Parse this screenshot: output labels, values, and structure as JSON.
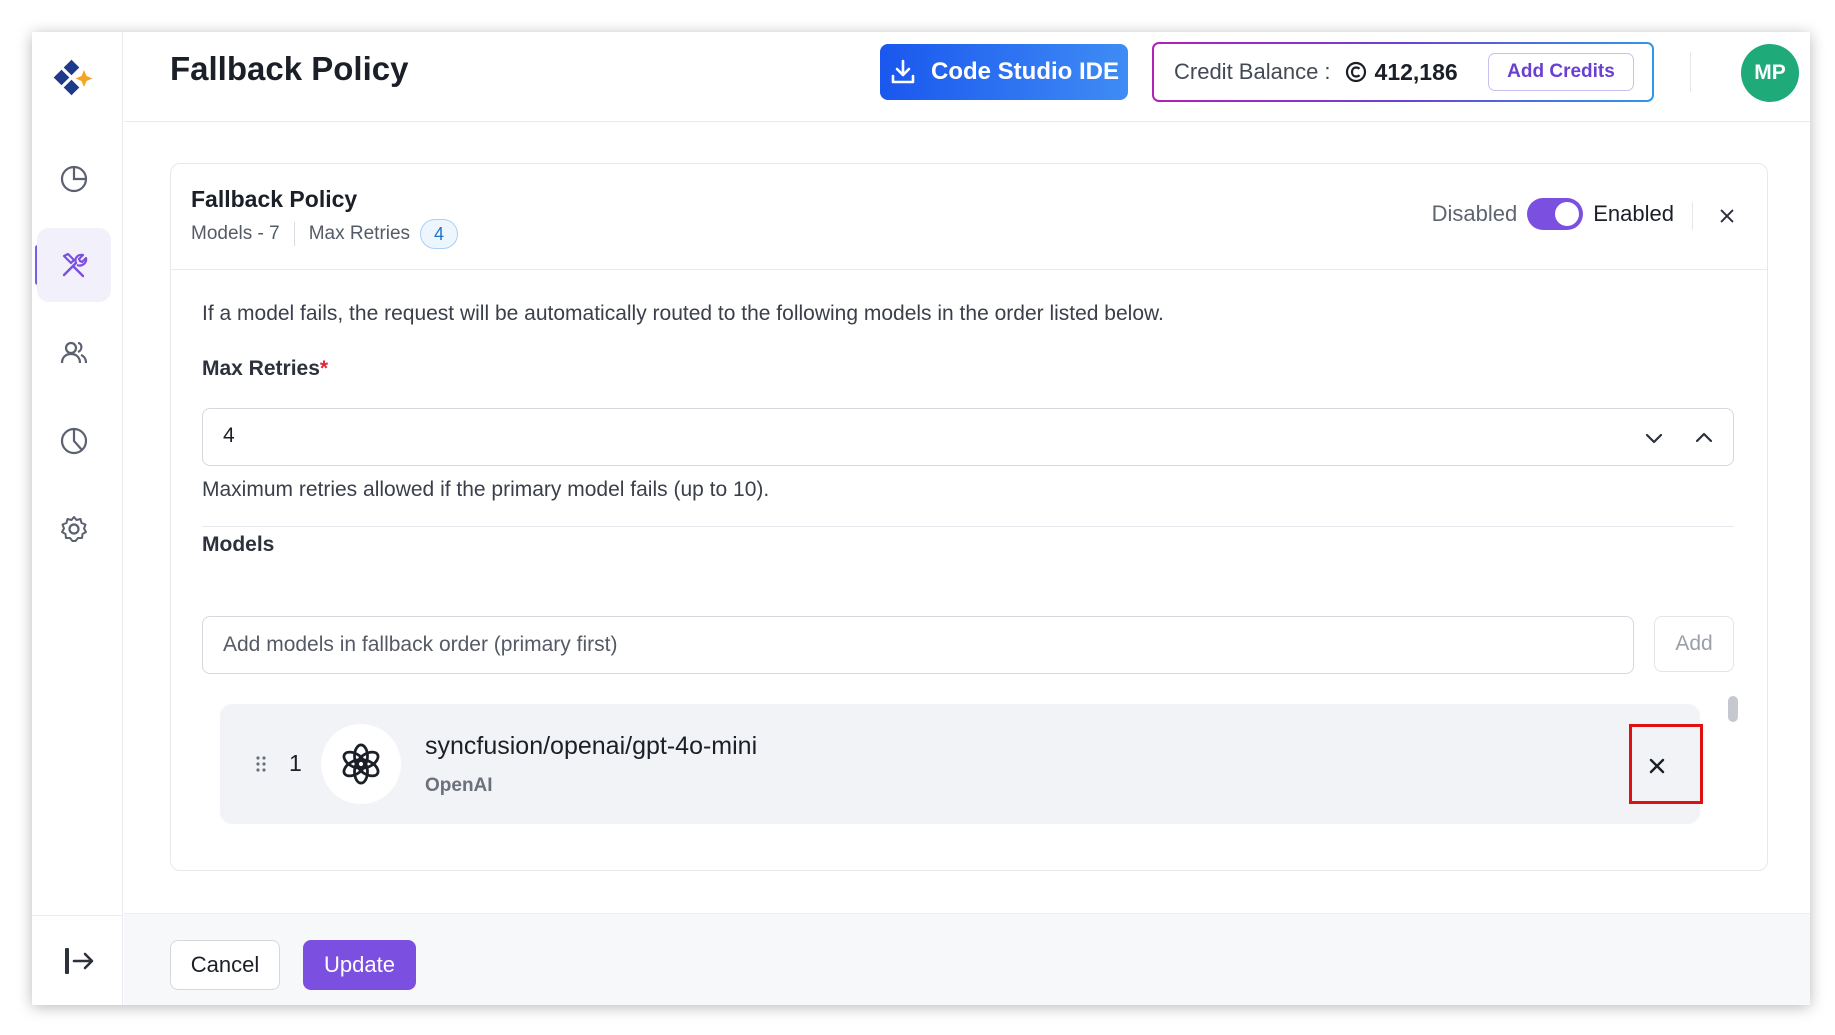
{
  "header": {
    "title": "Fallback Policy",
    "ide_button_label": "Code Studio IDE",
    "credit_label": "Credit Balance :",
    "credit_value": "412,186",
    "add_credits_label": "Add Credits",
    "avatar_initials": "MP"
  },
  "sidebar": {
    "items": [
      {
        "name": "dashboard",
        "icon": "pie-chart-icon",
        "active": false
      },
      {
        "name": "tools",
        "icon": "tools-icon",
        "active": true
      },
      {
        "name": "users",
        "icon": "users-icon",
        "active": false
      },
      {
        "name": "analytics",
        "icon": "analytics-icon",
        "active": false
      },
      {
        "name": "settings",
        "icon": "gear-icon",
        "active": false
      }
    ],
    "logout_icon": "logout-icon"
  },
  "card": {
    "title": "Fallback Policy",
    "models_meta": "Models - 7",
    "max_retries_meta": "Max Retries",
    "max_retries_badge": "4",
    "toggle_off_label": "Disabled",
    "toggle_on_label": "Enabled",
    "toggle_state": "enabled"
  },
  "form": {
    "description": "If a model fails, the request will be automatically routed to the following models in the order listed below.",
    "max_retries_label": "Max Retries",
    "required_mark": "*",
    "max_retries_value": "4",
    "max_retries_hint": "Maximum retries allowed if the primary model fails (up to 10).",
    "models_label": "Models",
    "models_placeholder": "Add models in fallback order (primary first)",
    "add_label": "Add"
  },
  "models": [
    {
      "order": "1",
      "name": "syncfusion/openai/gpt-4o-mini",
      "provider": "OpenAI",
      "icon": "openai-icon"
    }
  ],
  "footer": {
    "cancel_label": "Cancel",
    "update_label": "Update"
  },
  "colors": {
    "accent": "#7b4fe0",
    "ide_button": "#1a57ee",
    "avatar": "#1eaa79",
    "highlight": "#e01010"
  }
}
